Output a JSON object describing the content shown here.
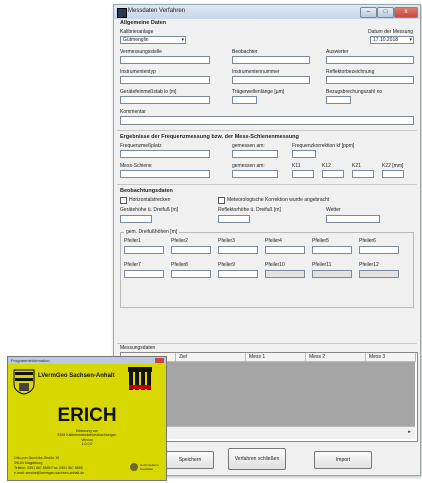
{
  "window": {
    "title": "Messdaten Verfahren",
    "min": "–",
    "max": "□",
    "close": "x"
  },
  "general": {
    "header": "Allgemeine Daten",
    "anlage_label": "Kalibrieranlage",
    "anlage_value": "Gütmenglin",
    "datum_label": "Datum der Messung",
    "datum_value": "17.10.2018",
    "vermessungsstelle": "Vermessungsstelle",
    "beobachter": "Beobachter",
    "auswerter": "Auswerter",
    "instrumententyp": "Instrumententyp",
    "instrumentennummer": "Instrumentennummer",
    "reflektor": "Reflektorbezeichnung",
    "geraetefeinmessstab": "Gerätefeinmeßstab lo [m]",
    "traegerwellenlaenge": "Trägerwellenlänge [µm]",
    "bezugsbrechung": "Bezugsbrechungszahl no",
    "kommentar": "Kommentar"
  },
  "freq": {
    "header": "Ergebnisse der Frequenzmessung bzw. der Mess-Schienenmessung",
    "frequenzmessplatz": "Frequenzmeßplatz",
    "gemessen_am": "gemessen am:",
    "frequenzkorrektion": "Frequenzkorrektion kf [ppm]",
    "mess_schiene": "Mess-Schiene",
    "k1": "K11",
    "k2": "K12",
    "k3": "K21",
    "k4": "K22 [mm]"
  },
  "beob": {
    "header": "Beobachtungsdaten",
    "horizontal": "Horizontalstrecken",
    "meteo": "Meteorologische Korrektion wurde angebracht",
    "gh_dreifuss": "Gerätehöhe ü. Dreifuß [m]",
    "rh_dreifuss": "Reflektorhöhe ü. Dreifuß [m]",
    "wetter": "Wetter",
    "group_label": "gem. Dreifußhöhen [m]",
    "pfeiler": [
      "Pfeiler1",
      "Pfeiler2",
      "Pfeiler3",
      "Pfeiler4",
      "Pfeiler5",
      "Pfeiler6",
      "Pfeiler7",
      "Pfeiler8",
      "Pfeiler9",
      "Pfeiler10",
      "Pfeiler11",
      "Pfeiler12"
    ]
  },
  "messdaten": {
    "header": "Messungsdaten",
    "cols": [
      "Ziel",
      "Mess 1",
      "Mess 2",
      "Mess 3"
    ]
  },
  "buttons": {
    "speichern": "Speichern",
    "schliessen": "Verfahren schließen",
    "import": "Import"
  },
  "splash": {
    "title": "Programminformation",
    "org": "LVermGeo Sachsen-Anhalt",
    "app": "ERICH",
    "sub1": "Erfassung von",
    "sub2": "EDM Kalibrierstreckenbeobachtungen",
    "sub3": "Version",
    "version": "1.0.0.0",
    "addr1": "Otto-von-Guericke-Straße 15",
    "addr2": "39104 Magdeburg",
    "tel": "Telefon: 0391 567 8585    Fax: 0391 567 8686",
    "mail": "e-mail: service@lvermgeo.sachsen-anhalt.de",
    "badge": "Hochmoderne Geodäten"
  },
  "colors": {
    "accent": "#3a66b0",
    "splash_bg": "#d8d800",
    "close": "#c9453a"
  }
}
